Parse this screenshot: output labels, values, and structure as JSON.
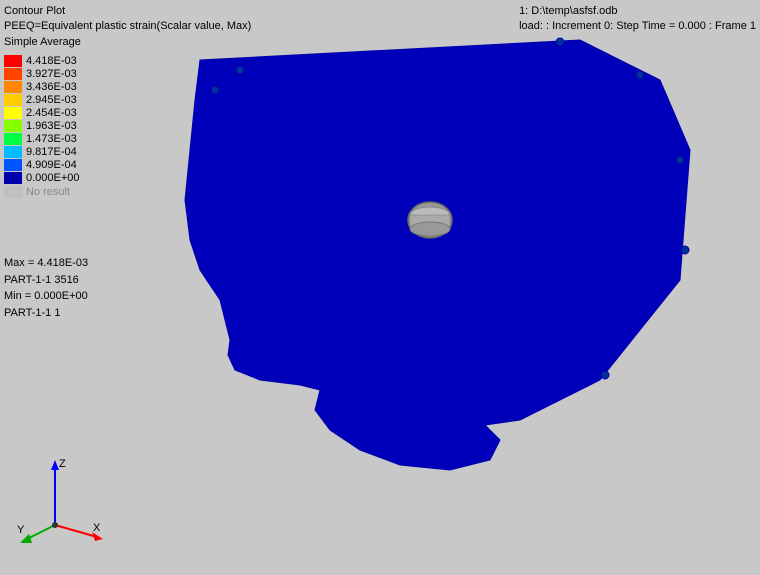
{
  "header": {
    "title": "Contour Plot",
    "subtitle": "PEEQ=Equivalent plastic strain(Scalar value, Max)",
    "avg_method": "Simple Average",
    "top_right": "1: D:\\temp\\asfsf.odb",
    "load_info": "load:  : Increment    0: Step Time =   0.000 : Frame 1"
  },
  "legend": {
    "items": [
      {
        "value": "4.418E-03",
        "color": "#FF0000"
      },
      {
        "value": "3.927E-03",
        "color": "#FF4400"
      },
      {
        "value": "3.436E-03",
        "color": "#FF8800"
      },
      {
        "value": "2.945E-03",
        "color": "#FFCC00"
      },
      {
        "value": "2.454E-03",
        "color": "#FFFF00"
      },
      {
        "value": "1.963E-03",
        "color": "#88FF00"
      },
      {
        "value": "1.473E-03",
        "color": "#00FF44"
      },
      {
        "value": "9.817E-04",
        "color": "#00BBFF"
      },
      {
        "value": "4.909E-04",
        "color": "#0055FF"
      },
      {
        "value": "0.000E+00",
        "color": "#0000AA"
      }
    ],
    "no_result_label": "No result"
  },
  "stats": {
    "max_label": "Max = 4.418E-03",
    "max_location": "PART-1-1 3516",
    "min_label": "Min = 0.000E+00",
    "min_location": "PART-1-1 1"
  },
  "axes": {
    "z_label": "Z",
    "y_label": "Y",
    "x_label": "X"
  }
}
